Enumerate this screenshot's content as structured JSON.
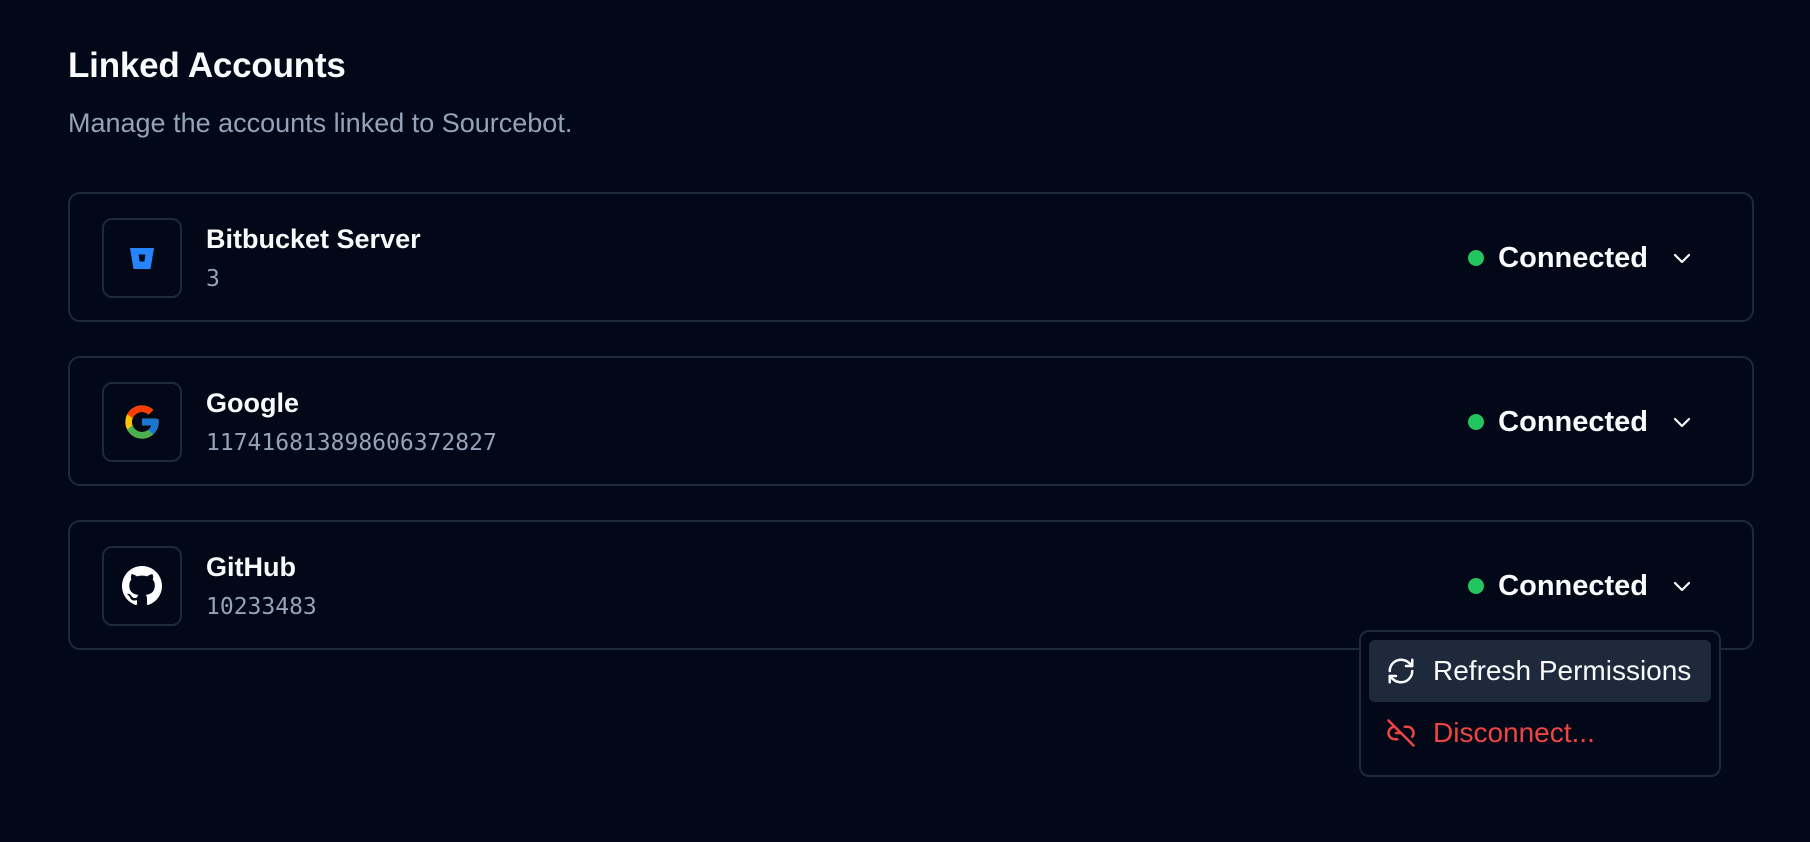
{
  "header": {
    "title": "Linked Accounts",
    "subtitle": "Manage the accounts linked to Sourcebot."
  },
  "accounts": [
    {
      "name": "Bitbucket Server",
      "id": "3",
      "status": "Connected",
      "icon": "bitbucket-icon"
    },
    {
      "name": "Google",
      "id": "117416813898606372827",
      "status": "Connected",
      "icon": "google-icon"
    },
    {
      "name": "GitHub",
      "id": "10233483",
      "status": "Connected",
      "icon": "github-icon"
    }
  ],
  "menu": {
    "items": [
      {
        "label": "Refresh Permissions",
        "icon": "refresh-icon"
      },
      {
        "label": "Disconnect...",
        "icon": "unlink-icon"
      }
    ]
  },
  "colors": {
    "background": "#020817",
    "border": "#1e293b",
    "connected": "#22c55e",
    "danger": "#ef4444",
    "muted_text": "#94a3b8",
    "bitbucket": "#2684FF"
  }
}
